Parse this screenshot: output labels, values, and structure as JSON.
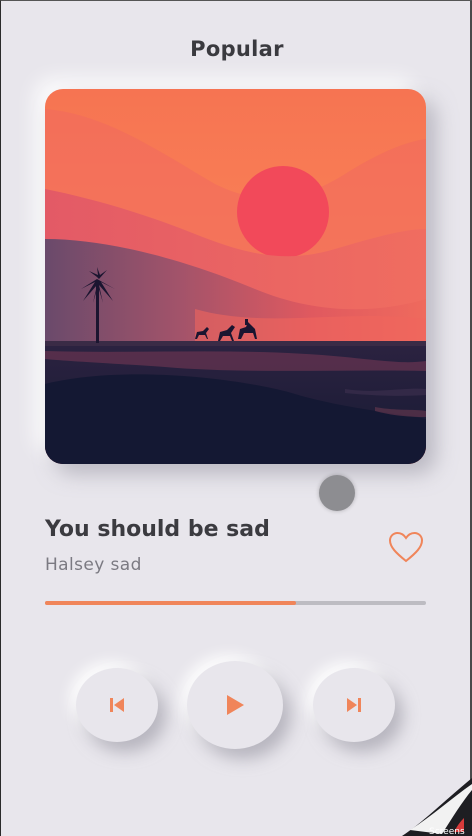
{
  "header": {
    "title": "Popular"
  },
  "track": {
    "title": "You should be sad",
    "artist": "Halsey sad",
    "progress": 0.66,
    "liked": false
  },
  "controls": {
    "previous_icon": "skip-previous-icon",
    "play_icon": "play-icon",
    "next_icon": "skip-next-icon",
    "heart_icon": "heart-outline-icon"
  },
  "colors": {
    "accent": "#f0855a",
    "background": "#e8e6ec",
    "text_primary": "#3b3b40",
    "text_secondary": "#7b7a82"
  },
  "overlay": {
    "corner_label": "Screens"
  }
}
